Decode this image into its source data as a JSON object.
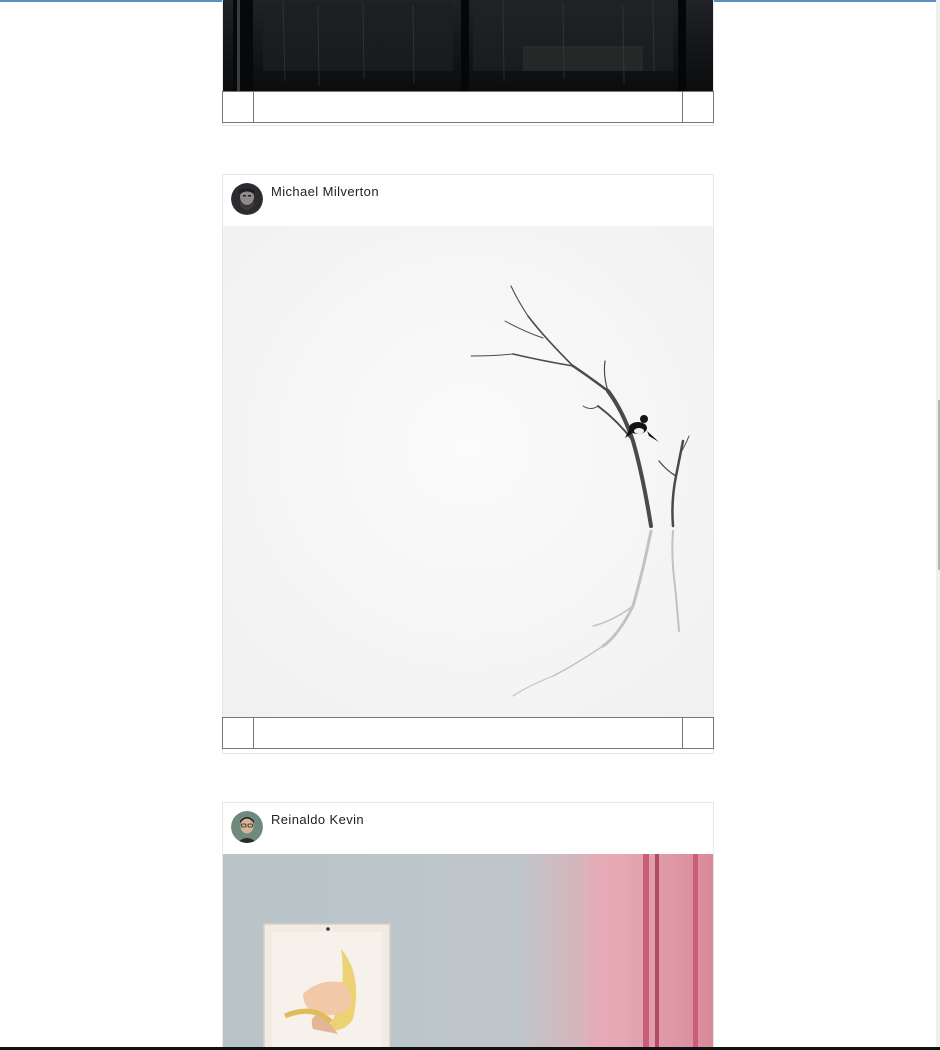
{
  "feed": {
    "posts": [
      {
        "username": "",
        "avatar_icon": "",
        "photo_alt": "dark-rainy-window-photo"
      },
      {
        "username": "Michael Milverton",
        "avatar_icon": "bearded-man-avatar",
        "photo_alt": "bird-on-bare-tree-in-fog-photo"
      },
      {
        "username": "Reinaldo Kevin",
        "avatar_icon": "man-with-glasses-avatar",
        "photo_alt": "banana-print-on-wall-photo"
      }
    ],
    "action_buttons": {
      "left": "",
      "right": ""
    }
  },
  "colors": {
    "top_accent": "#5a8fc2",
    "card_border": "#e8e8e8",
    "action_border": "#777777"
  }
}
